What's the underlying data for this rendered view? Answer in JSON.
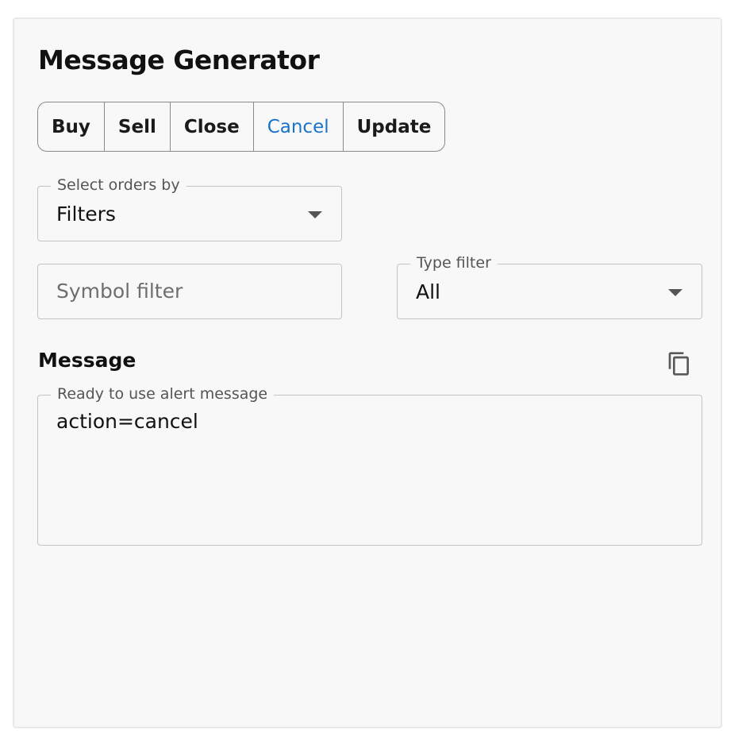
{
  "app": {
    "title": "Message Generator"
  },
  "action_tabs": {
    "items": [
      {
        "label": "Buy",
        "selected": false
      },
      {
        "label": "Sell",
        "selected": false
      },
      {
        "label": "Close",
        "selected": false
      },
      {
        "label": "Cancel",
        "selected": true
      },
      {
        "label": "Update",
        "selected": false
      }
    ],
    "selected_color": "#1a73c7"
  },
  "select_orders": {
    "label": "Select orders by",
    "value": "Filters"
  },
  "symbol_filter": {
    "placeholder": "Symbol filter",
    "value": ""
  },
  "type_filter": {
    "label": "Type filter",
    "value": "All"
  },
  "message_section": {
    "title": "Message",
    "copy_icon": "copy-icon",
    "field_label": "Ready to use alert message",
    "value": "action=cancel"
  }
}
